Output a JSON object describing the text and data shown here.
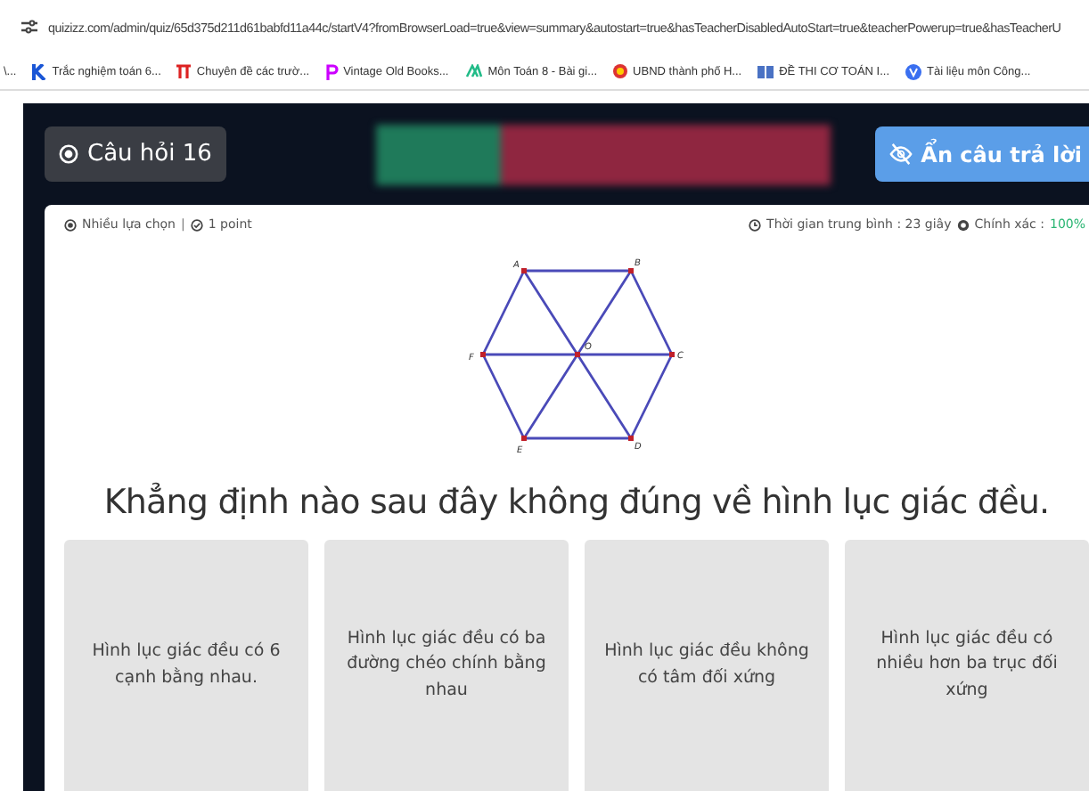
{
  "browser": {
    "url": "quizizz.com/admin/quiz/65d375d211d61babfd11a44c/startV4?fromBrowserLoad=true&view=summary&autostart=true&hasTeacherDisabledAutoStart=true&teacherPowerup=true&hasTeacherU",
    "bookmarks": [
      {
        "label": "\\...",
        "kind": "none"
      },
      {
        "label": "Trắc nghiệm toán 6...",
        "kind": "k"
      },
      {
        "label": "Chuyên đề các trườ...",
        "kind": "pi"
      },
      {
        "label": "Vintage Old Books...",
        "kind": "p"
      },
      {
        "label": "Môn Toán 8 - Bài gi...",
        "kind": "m"
      },
      {
        "label": "UBND thành phố H...",
        "kind": "emblem"
      },
      {
        "label": "ĐỀ THI CƠ TOÁN I...",
        "kind": "book"
      },
      {
        "label": "Tài liệu môn Công...",
        "kind": "v"
      }
    ]
  },
  "header": {
    "question_button": "Câu hỏi 16",
    "hide_button": "Ẩn câu trả lời"
  },
  "meta": {
    "type": "Nhiều lựa chọn",
    "separator": "|",
    "points": "1 point",
    "avg_time": "Thời gian trung bình : 23 giây",
    "accuracy_label": "Chính xác :",
    "accuracy": "100%"
  },
  "figure": {
    "labels": [
      "A",
      "B",
      "C",
      "D",
      "E",
      "F",
      "O"
    ]
  },
  "question": "Khẳng định nào sau đây không đúng về hình lục giác đều.",
  "answers": [
    "Hình lục giác đều có 6 cạnh bằng nhau.",
    "Hình lục giác đều có ba đường chéo chính bằng nhau",
    "Hình lục giác đều không có tâm đối xứng",
    "Hình lục giác đều có nhiều hơn ba trục đối xứng"
  ]
}
